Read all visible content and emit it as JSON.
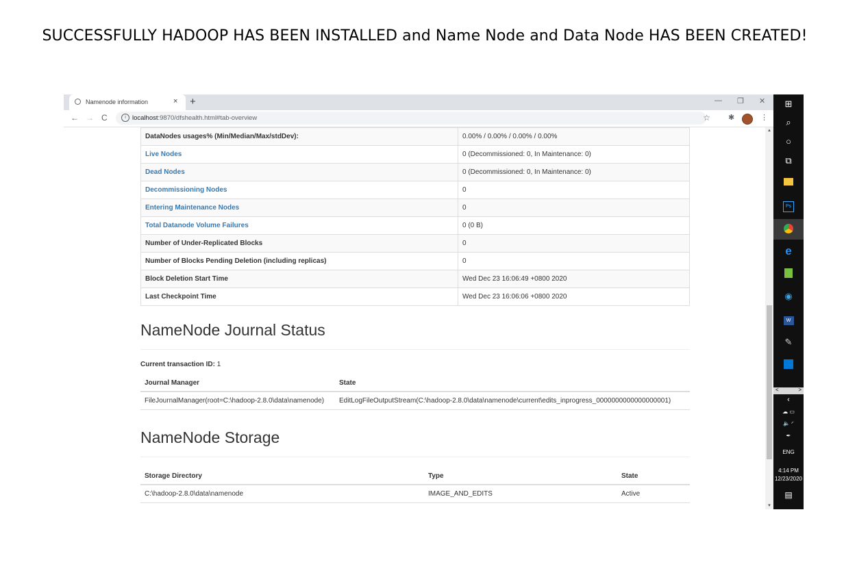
{
  "headline": "SUCCESSFULLY HADOOP HAS BEEN INSTALLED and Name Node and Data Node HAS BEEN CREATED!",
  "browser": {
    "tab_title": "Namenode information",
    "tab_close": "×",
    "new_tab": "+",
    "window_controls": {
      "minimize": "—",
      "restore": "❐",
      "close": "✕"
    },
    "nav": {
      "back": "←",
      "forward": "→",
      "reload": "C"
    },
    "url_host": "localhost",
    "url_path": ":9870/dfshealth.html#tab-overview",
    "bookmark_icon": "star-icon",
    "star": "☆",
    "puzzle": "✱",
    "menu": "⋮"
  },
  "summary_rows": [
    {
      "key": "DataNodes usages% (Min/Median/Max/stdDev):",
      "value": "0.00% / 0.00% / 0.00% / 0.00%",
      "link": false
    },
    {
      "key": "Live Nodes",
      "value": "0 (Decommissioned: 0, In Maintenance: 0)",
      "link": true
    },
    {
      "key": "Dead Nodes",
      "value": "0 (Decommissioned: 0, In Maintenance: 0)",
      "link": true
    },
    {
      "key": "Decommissioning Nodes",
      "value": "0",
      "link": true
    },
    {
      "key": "Entering Maintenance Nodes",
      "value": "0",
      "link": true
    },
    {
      "key": "Total Datanode Volume Failures",
      "value": "0 (0 B)",
      "link": true
    },
    {
      "key": "Number of Under-Replicated Blocks",
      "value": "0",
      "link": false
    },
    {
      "key": "Number of Blocks Pending Deletion (including replicas)",
      "value": "0",
      "link": false
    },
    {
      "key": "Block Deletion Start Time",
      "value": "Wed Dec 23 16:06:49 +0800 2020",
      "link": false
    },
    {
      "key": "Last Checkpoint Time",
      "value": "Wed Dec 23 16:06:06 +0800 2020",
      "link": false
    }
  ],
  "journal": {
    "heading": "NameNode Journal Status",
    "txid_label": "Current transaction ID:",
    "txid_value": "1",
    "columns": [
      "Journal Manager",
      "State"
    ],
    "rows": [
      [
        "FileJournalManager(root=C:\\hadoop-2.8.0\\data\\namenode)",
        "EditLogFileOutputStream(C:\\hadoop-2.8.0\\data\\namenode\\current\\edits_inprogress_0000000000000000001)"
      ]
    ]
  },
  "storage": {
    "heading": "NameNode Storage",
    "columns": [
      "Storage Directory",
      "Type",
      "State"
    ],
    "rows": [
      [
        "C:\\hadoop-2.8.0\\data\\namenode",
        "IMAGE_AND_EDITS",
        "Active"
      ]
    ]
  },
  "taskbar": {
    "apps": [
      "windows-start-icon",
      "search-icon",
      "cortana-icon",
      "task-view-icon",
      "file-explorer-icon",
      "photoshop-icon",
      "chrome-icon",
      "edge-icon",
      "notepad-icon",
      "internet-explorer-icon",
      "word-icon",
      "paint-icon",
      "photos-icon"
    ],
    "ps_label": "Ps",
    "lang": "ENG",
    "time": "4:14 PM",
    "date": "12/23/2020"
  }
}
